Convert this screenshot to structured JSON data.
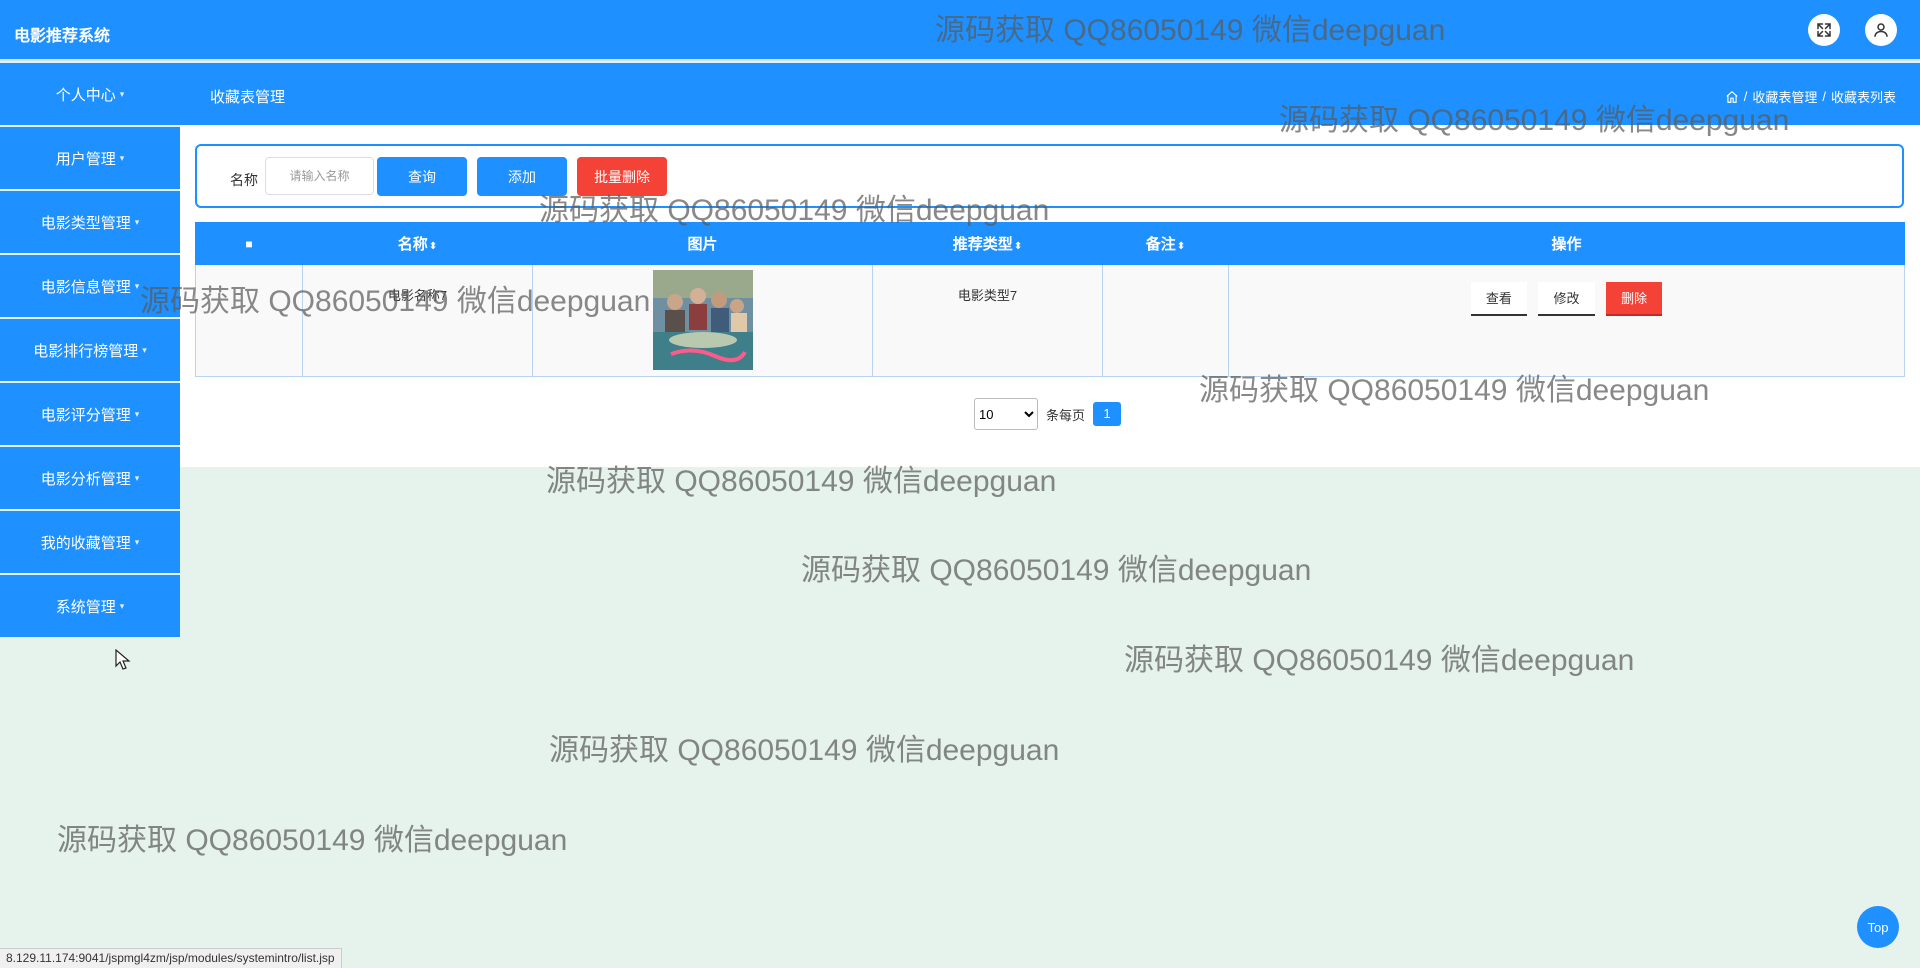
{
  "header": {
    "app_title": "电影推荐系统",
    "icons": [
      "fullscreen-icon",
      "user-icon"
    ]
  },
  "navbar": {
    "page_title": "收藏表管理",
    "breadcrumb": [
      "收藏表管理",
      "收藏表列表"
    ],
    "breadcrumb_sep": "/"
  },
  "sidebar": {
    "items": [
      {
        "label": "个人中心"
      },
      {
        "label": "用户管理"
      },
      {
        "label": "电影类型管理"
      },
      {
        "label": "电影信息管理"
      },
      {
        "label": "电影排行榜管理"
      },
      {
        "label": "电影评分管理"
      },
      {
        "label": "电影分析管理"
      },
      {
        "label": "我的收藏管理"
      },
      {
        "label": "系统管理"
      }
    ]
  },
  "search": {
    "label": "名称",
    "placeholder": "请输入名称",
    "query_label": "查询",
    "add_label": "添加",
    "batch_delete_label": "批量删除"
  },
  "table": {
    "columns": [
      "■",
      "名称",
      "图片",
      "推荐类型",
      "备注",
      "操作"
    ],
    "sort_glyph": "⬍",
    "rows": [
      {
        "name": "电影名称7",
        "type": "电影类型7",
        "remark": ""
      }
    ],
    "actions": {
      "view": "查看",
      "edit": "修改",
      "delete": "删除"
    }
  },
  "pagination": {
    "page_size": "10",
    "page_size_options": [
      "10"
    ],
    "per_page_label": "条每页",
    "current_page": "1"
  },
  "watermark": "源码获取 QQ86050149 微信deepguan",
  "top_button_label": "Top",
  "status_url": "8.129.11.174:9041/jspmgl4zm/jsp/modules/systemintro/list.jsp",
  "colors": {
    "primary": "#1e90ff",
    "danger": "#f44336",
    "page_bg": "#e6f2ec"
  }
}
